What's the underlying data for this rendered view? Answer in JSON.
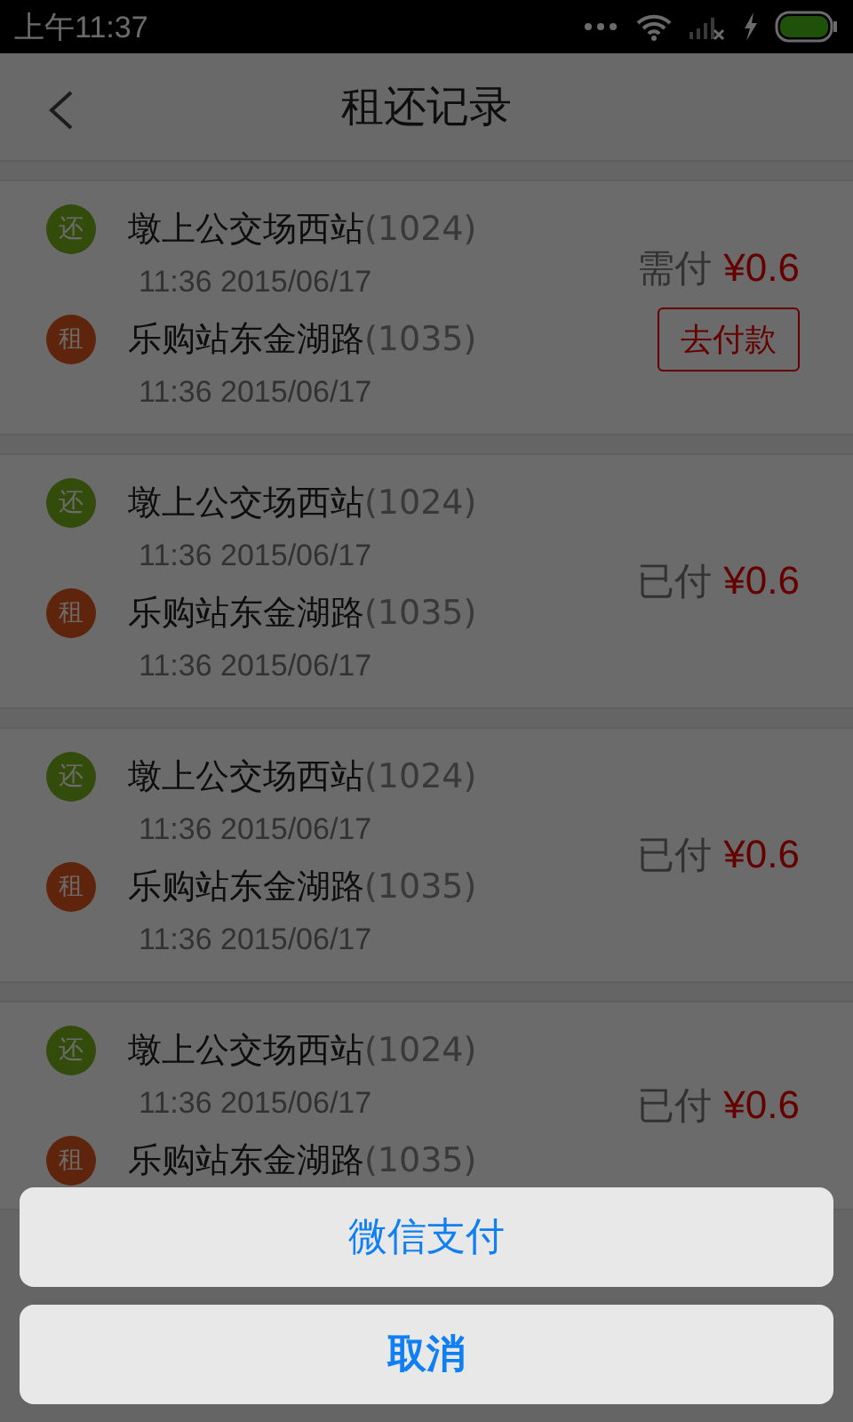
{
  "status_bar": {
    "time": "上午11:37"
  },
  "header": {
    "title": "租还记录"
  },
  "records": [
    {
      "legs": [
        {
          "kind": "return",
          "badge": "还",
          "station": "墩上公交场西站",
          "code": "(1024)",
          "time": "11:36 2015/06/17"
        },
        {
          "kind": "rent",
          "badge": "租",
          "station": "乐购站东金湖路",
          "code": "(1035)",
          "time": "11:36 2015/06/17"
        }
      ],
      "status": "需付",
      "amount": "¥0.6",
      "pay_button": "去付款"
    },
    {
      "legs": [
        {
          "kind": "return",
          "badge": "还",
          "station": "墩上公交场西站",
          "code": "(1024)",
          "time": "11:36 2015/06/17"
        },
        {
          "kind": "rent",
          "badge": "租",
          "station": "乐购站东金湖路",
          "code": "(1035)",
          "time": "11:36 2015/06/17"
        }
      ],
      "status": "已付",
      "amount": "¥0.6"
    },
    {
      "legs": [
        {
          "kind": "return",
          "badge": "还",
          "station": "墩上公交场西站",
          "code": "(1024)",
          "time": "11:36 2015/06/17"
        },
        {
          "kind": "rent",
          "badge": "租",
          "station": "乐购站东金湖路",
          "code": "(1035)",
          "time": "11:36 2015/06/17"
        }
      ],
      "status": "已付",
      "amount": "¥0.6"
    },
    {
      "legs": [
        {
          "kind": "return",
          "badge": "还",
          "station": "墩上公交场西站",
          "code": "(1024)",
          "time": "11:36 2015/06/17"
        },
        {
          "kind": "rent",
          "badge": "租",
          "station": "乐购站东金湖路",
          "code": "(1035)"
        }
      ],
      "status": "已付",
      "amount": "¥0.6"
    }
  ],
  "action_sheet": {
    "options": [
      "微信支付"
    ],
    "cancel": "取消"
  }
}
